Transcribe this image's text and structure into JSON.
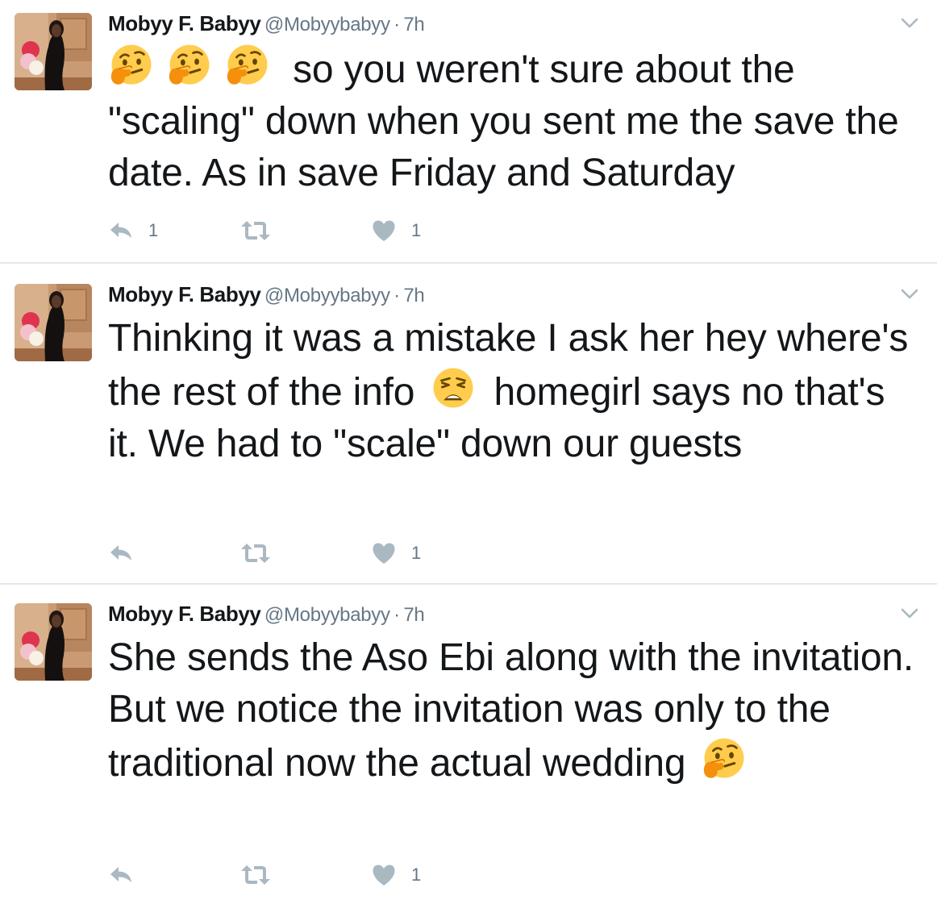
{
  "author": {
    "name": "Mobyy F. Babyy",
    "handle": "@Mobyybabyy",
    "separator": "·"
  },
  "icons": {
    "reply": "reply-icon",
    "retweet": "retweet-icon",
    "like": "heart-icon",
    "more": "chevron-down-icon",
    "emoji_thinking": "thinking-face-emoji",
    "emoji_weary": "weary-face-emoji"
  },
  "colors": {
    "text": "#14171a",
    "meta": "#657786",
    "icon": "#aab8c2",
    "divider": "#e1e8ed",
    "emoji": "#ffcc4d"
  },
  "tweets": [
    {
      "time": "7h",
      "text_parts": [
        "so you weren't sure about the \"scaling\" down when you sent me the save the date. As in save Friday and Saturday"
      ],
      "reply_count": "1",
      "retweet_count": "",
      "like_count": "1"
    },
    {
      "time": "7h",
      "text_parts": [
        "Thinking it was a mistake I ask her hey where's the rest of the info",
        "homegirl says no that's it. We had to \"scale\" down our guests"
      ],
      "reply_count": "",
      "retweet_count": "",
      "like_count": "1"
    },
    {
      "time": "7h",
      "text_parts": [
        "She sends the Aso Ebi along with the invitation. But we notice the invitation was only to the traditional now the actual wedding"
      ],
      "reply_count": "",
      "retweet_count": "",
      "like_count": "1"
    }
  ]
}
